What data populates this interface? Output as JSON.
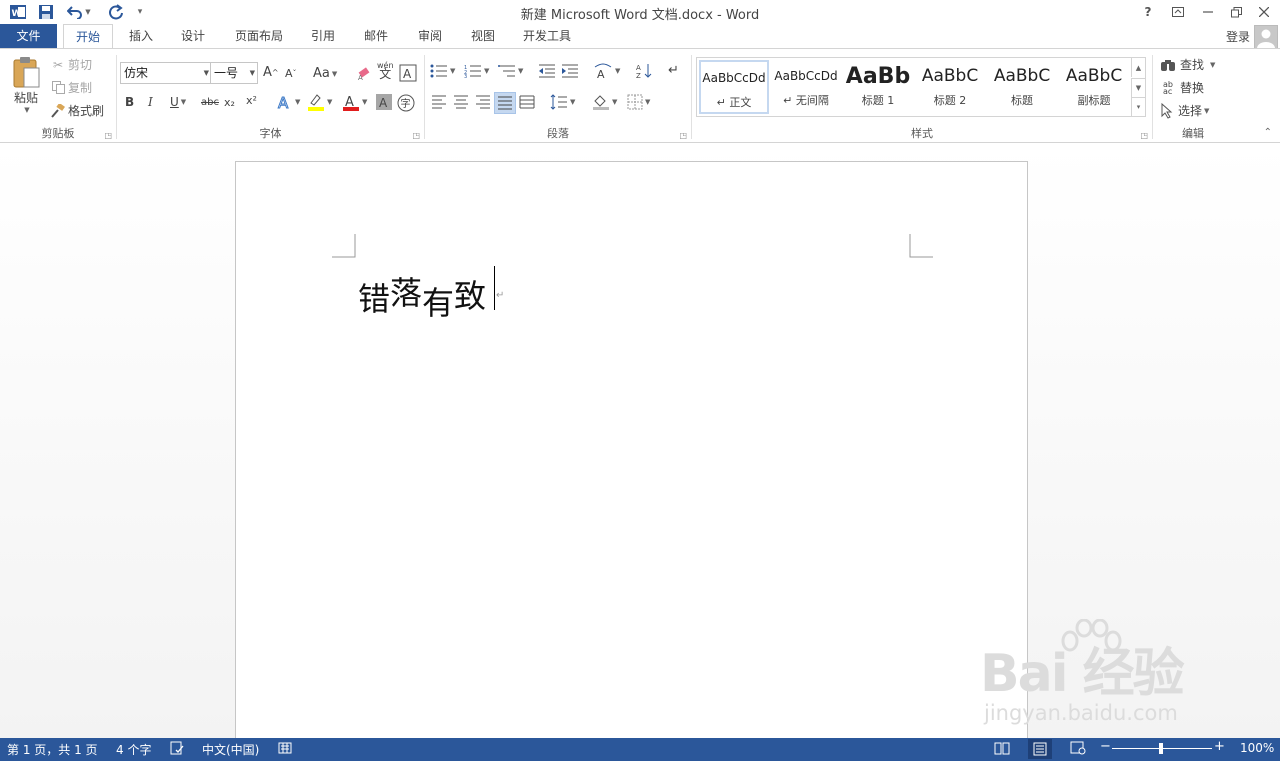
{
  "window": {
    "title": "新建 Microsoft Word 文档.docx - Word",
    "help_label": "?"
  },
  "tabs": {
    "file": "文件",
    "items": [
      "开始",
      "插入",
      "设计",
      "页面布局",
      "引用",
      "邮件",
      "审阅",
      "视图",
      "开发工具"
    ],
    "login": "登录"
  },
  "clipboard": {
    "paste": "粘贴",
    "cut": "剪切",
    "copy": "复制",
    "format_painter": "格式刷",
    "label": "剪贴板"
  },
  "font": {
    "name": "仿宋",
    "size": "一号",
    "grow_label": "A",
    "shrink_label": "A",
    "case_label": "Aa",
    "bold": "B",
    "italic": "I",
    "underline": "U",
    "strike": "abc",
    "subscript": "x₂",
    "superscript": "x²",
    "pinyin": "wén",
    "label": "字体"
  },
  "paragraph": {
    "label": "段落"
  },
  "styles": {
    "label": "样式",
    "items": [
      {
        "sample": "AaBbCcDd",
        "name": "↵ 正文"
      },
      {
        "sample": "AaBbCcDd",
        "name": "↵ 无间隔"
      },
      {
        "sample": "AaBb",
        "name": "标题 1"
      },
      {
        "sample": "AaBbC",
        "name": "标题 2"
      },
      {
        "sample": "AaBbC",
        "name": "标题"
      },
      {
        "sample": "AaBbC",
        "name": "副标题"
      }
    ]
  },
  "editing": {
    "find": "查找",
    "replace": "替换",
    "select": "选择",
    "label": "编辑"
  },
  "document": {
    "chars": [
      "错",
      "落",
      "有",
      "致"
    ],
    "paragraph_mark": "↵"
  },
  "watermark": {
    "brand": "Bai 经验",
    "url": "jingyan.baidu.com"
  },
  "statusbar": {
    "page": "第 1 页，共 1 页",
    "words": "4 个字",
    "language": "中文(中国)",
    "zoom": "100%"
  },
  "colors": {
    "accent": "#2b579a",
    "highlight": "#ffff00",
    "font_color": "#e11d1d"
  }
}
